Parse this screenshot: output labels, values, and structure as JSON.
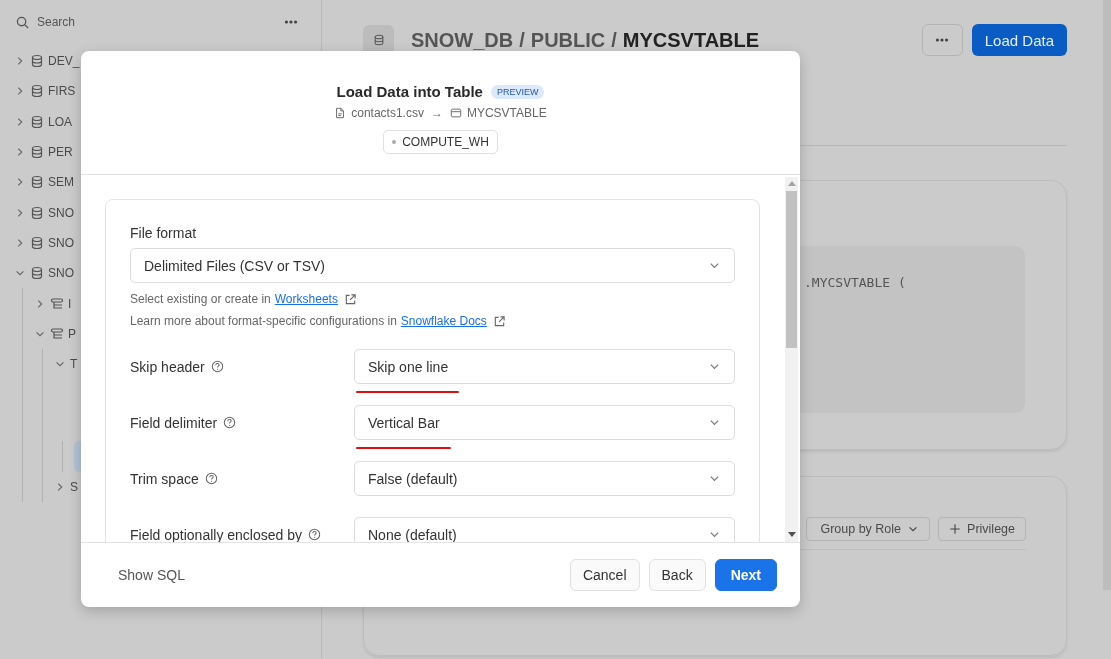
{
  "sidebar": {
    "search": {
      "placeholder": "Search"
    },
    "items": [
      {
        "label": "DEV_",
        "kind": "database",
        "expanded": false,
        "selected": false
      },
      {
        "label": "FIRS",
        "kind": "database",
        "expanded": false,
        "selected": false
      },
      {
        "label": "LOA",
        "kind": "database",
        "expanded": false,
        "selected": false
      },
      {
        "label": "PER",
        "kind": "database",
        "expanded": false,
        "selected": false
      },
      {
        "label": "SEM",
        "kind": "database",
        "expanded": false,
        "selected": false
      },
      {
        "label": "SNO",
        "kind": "database",
        "expanded": false,
        "selected": false
      },
      {
        "label": "SNO",
        "kind": "database",
        "expanded": false,
        "selected": false
      },
      {
        "label": "SNO",
        "kind": "database",
        "expanded": true,
        "selected": false,
        "children": [
          {
            "label": "I",
            "kind": "schema",
            "expanded": false,
            "selected": false
          },
          {
            "label": "P",
            "kind": "schema",
            "expanded": true,
            "selected": false,
            "children": [
              {
                "label": "T",
                "expanded": true,
                "selected": false,
                "children": [
                  {
                    "selected": true
                  }
                ]
              },
              {
                "label": "S",
                "expanded": false,
                "selected": false
              }
            ]
          }
        ]
      }
    ]
  },
  "header": {
    "breadcrumb": [
      {
        "text": "SNOW_DB",
        "current": false
      },
      {
        "text": "PUBLIC",
        "current": false
      },
      {
        "text": "MYCSVTABLE",
        "current": true
      }
    ],
    "separator": "/",
    "primary_button": "Load Data"
  },
  "definition_card": {
    "code_lines": [
      ".MYCSVTABLE ("
    ]
  },
  "privileges_card": {
    "buttons": [
      {
        "label": "Group by Role",
        "kind": "dropdown"
      },
      {
        "label": "Privilege",
        "kind": "add"
      }
    ]
  },
  "dialog": {
    "title": "Load Data into Table",
    "badge": "PREVIEW",
    "source_file": "contacts1.csv",
    "arrow": "→",
    "target_table": "MYCSVTABLE",
    "warehouse": "COMPUTE_WH",
    "file_format": {
      "label": "File format",
      "value": "Delimited Files (CSV or TSV)"
    },
    "help_lines": [
      {
        "text": "Select existing or create in",
        "link": "Worksheets"
      },
      {
        "text": "Learn more about format-specific configurations in",
        "link": "Snowflake Docs"
      }
    ],
    "options": [
      {
        "label": "Skip header",
        "value": "Skip one line",
        "underlined": true
      },
      {
        "label": "Field delimiter",
        "value": "Vertical Bar",
        "underlined": true
      },
      {
        "label": "Trim space",
        "value": "False (default)",
        "underlined": false
      },
      {
        "label": "Field optionally enclosed by",
        "value": "None (default)",
        "underlined": false
      }
    ],
    "footer": {
      "link": "Show SQL",
      "buttons": [
        {
          "label": "Cancel",
          "kind": "secondary"
        },
        {
          "label": "Back",
          "kind": "secondary"
        },
        {
          "label": "Next",
          "kind": "primary"
        }
      ]
    }
  }
}
